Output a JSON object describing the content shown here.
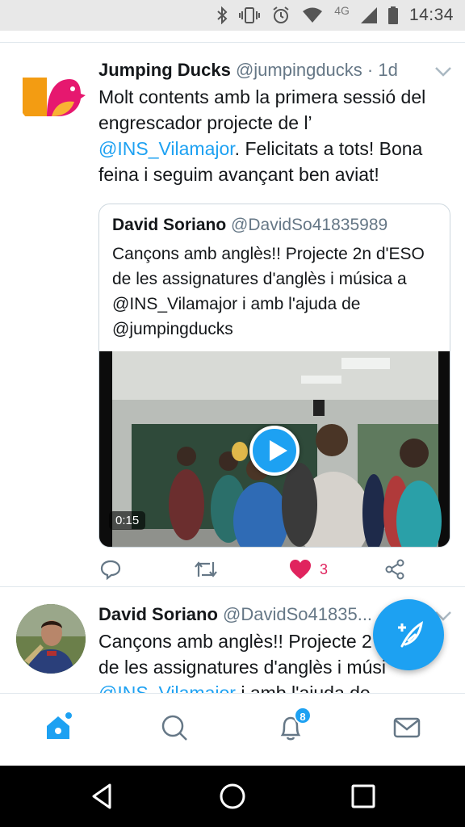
{
  "status_bar": {
    "time": "14:34",
    "network": "4G",
    "icons": [
      "bluetooth-icon",
      "vibrate-icon",
      "alarm-icon",
      "wifi-icon",
      "signal-icon",
      "battery-icon"
    ]
  },
  "tweet1": {
    "name": "Jumping Ducks",
    "handle": "@jumpingducks",
    "time": "· 1d",
    "text_line1": "Molt contents amb la primera sessió del",
    "text_line2": "engrescador projecte de l’",
    "text_mention": "@INS_Vilamajor",
    "text_rest1": ". Felicitats a tots! Bona",
    "text_line4": "feina i seguim avançant ben aviat!",
    "quote": {
      "name": "David Soriano",
      "handle": "@DavidSo41835989",
      "text": "Cançons amb anglès!! Projecte 2n d'ESO de les assignatures d'anglès i música a @INS_Vilamajor i amb l'ajuda de @jumpingducks",
      "video_duration": "0:15"
    },
    "actions": {
      "likes": "3",
      "icons": [
        "reply-icon",
        "retweet-icon",
        "heart-icon",
        "share-icon"
      ]
    }
  },
  "tweet2": {
    "name": "David Soriano",
    "handle": "@DavidSo41835...",
    "text_line1": "Cançons amb anglès!! Projecte 2",
    "text_line2": "de les assignatures d'anglès i músi",
    "text_mention": "@INS_Vilamajor",
    "text_rest": " i amb l'ajuda de"
  },
  "navbar": {
    "notifications_badge": "8",
    "icons": [
      "home-icon",
      "search-icon",
      "notifications-icon",
      "messages-icon"
    ]
  },
  "colors": {
    "accent": "#1da1f2",
    "like": "#e0245e",
    "text_secondary": "#657786"
  }
}
